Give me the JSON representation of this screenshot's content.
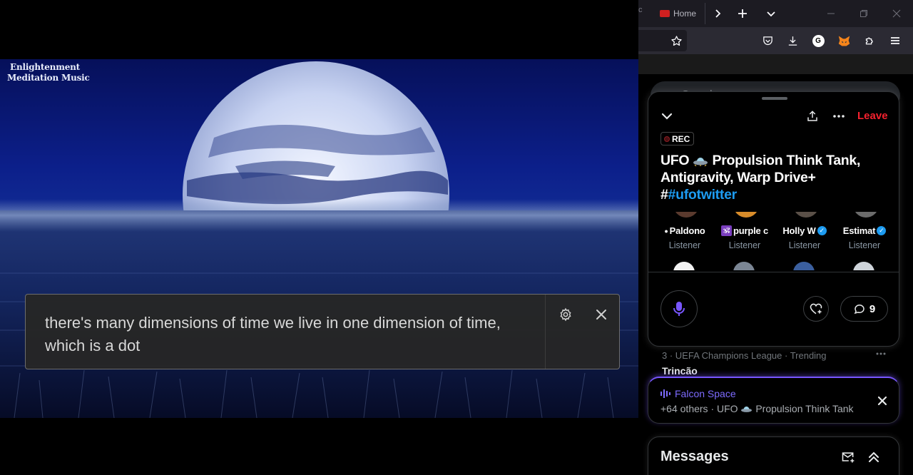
{
  "video": {
    "channel_logo_line1": "Enlightenment",
    "channel_logo_line2": "Meditation Music",
    "caption_text": "there's many dimensions of time we live in one dimension of time, which is a dot"
  },
  "browser": {
    "tab_prev_fragment": "c",
    "tab_home_label": "Home",
    "search_placeholder": "Search"
  },
  "space": {
    "leave_label": "Leave",
    "rec_label": "REC",
    "title_part1": "UFO",
    "title_part2": "Propulsion Think Tank, Antigravity, Warp Drive+",
    "title_hash_prefix": "#",
    "title_hashtag": "#ufotwitter",
    "listeners": [
      {
        "name": "Paldono",
        "prefix": "●",
        "role": "Listener",
        "verified": false
      },
      {
        "name": "purple c",
        "prefix": "🕉",
        "role": "Listener",
        "verified": false
      },
      {
        "name": "Holly W",
        "prefix": "",
        "role": "Listener",
        "verified": true
      },
      {
        "name": "Estimat",
        "prefix": "",
        "role": "Listener",
        "verified": true
      }
    ],
    "comment_count": "9"
  },
  "trending": {
    "meta": "3 · UEFA Champions League · Trending",
    "name": "Trincão"
  },
  "falcon": {
    "title": "Falcon Space",
    "subtitle_prefix": "+64 others · UFO",
    "subtitle_suffix": "Propulsion Think Tank"
  },
  "messages": {
    "title": "Messages"
  },
  "colors": {
    "accent_blue": "#1d9bf0",
    "leave_red": "#f4212e",
    "falcon_purple": "#7856ff",
    "mic_purple": "#7856ff"
  }
}
